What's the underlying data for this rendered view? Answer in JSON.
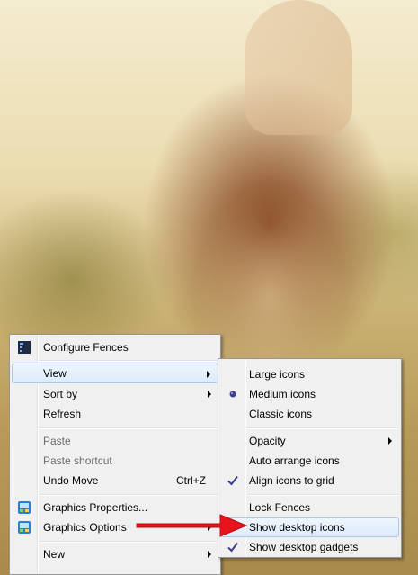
{
  "main_menu": {
    "items": [
      {
        "label": "Configure Fences"
      },
      {
        "label": "View"
      },
      {
        "label": "Sort by"
      },
      {
        "label": "Refresh"
      },
      {
        "label": "Paste"
      },
      {
        "label": "Paste shortcut"
      },
      {
        "label": "Undo Move",
        "shortcut": "Ctrl+Z"
      },
      {
        "label": "Graphics Properties..."
      },
      {
        "label": "Graphics Options"
      },
      {
        "label": "New"
      }
    ]
  },
  "view_submenu": {
    "items": [
      {
        "label": "Large icons"
      },
      {
        "label": "Medium icons",
        "selected": true
      },
      {
        "label": "Classic icons"
      },
      {
        "label": "Opacity"
      },
      {
        "label": "Auto arrange icons"
      },
      {
        "label": "Align icons to grid",
        "checked": true
      },
      {
        "label": "Lock Fences"
      },
      {
        "label": "Show desktop icons",
        "highlighted": true
      },
      {
        "label": "Show desktop gadgets",
        "checked": true
      }
    ]
  },
  "colors": {
    "menu_background": "#f0f0f0",
    "highlight": "#dcebfc",
    "highlight_border": "#a8c8ee",
    "arrow": "#e8141d"
  }
}
